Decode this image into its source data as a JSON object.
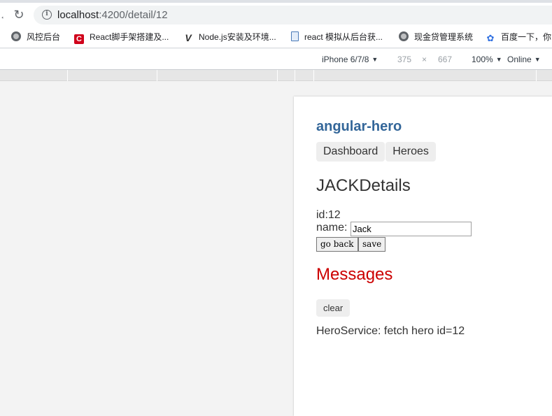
{
  "browser": {
    "url_host": "localhost",
    "url_path": ":4200/detail/12",
    "bookmarks": [
      {
        "label": "风控后台",
        "icon": "globe-icon"
      },
      {
        "label": "React脚手架搭建及...",
        "icon": "c-logo-icon"
      },
      {
        "label": "Node.js安装及环境...",
        "icon": "v-logo-icon"
      },
      {
        "label": "react 模拟从后台获...",
        "icon": "document-icon"
      },
      {
        "label": "现金贷管理系统",
        "icon": "globe-icon"
      },
      {
        "label": "百度一下，你",
        "icon": "paw-icon"
      }
    ]
  },
  "devtools": {
    "device": "iPhone 6/7/8",
    "width": "375",
    "times": "×",
    "height": "667",
    "zoom": "100%",
    "network": "Online"
  },
  "app": {
    "title": "angular-hero",
    "nav": [
      "Dashboard",
      "Heroes"
    ],
    "detail_title": "JACKDetails",
    "id_text": "id:12",
    "name_label": "name:",
    "name_value": "Jack",
    "go_back": "go back",
    "save": "save",
    "messages_title": "Messages",
    "clear": "clear",
    "message": "HeroService: fetch hero id=12"
  }
}
